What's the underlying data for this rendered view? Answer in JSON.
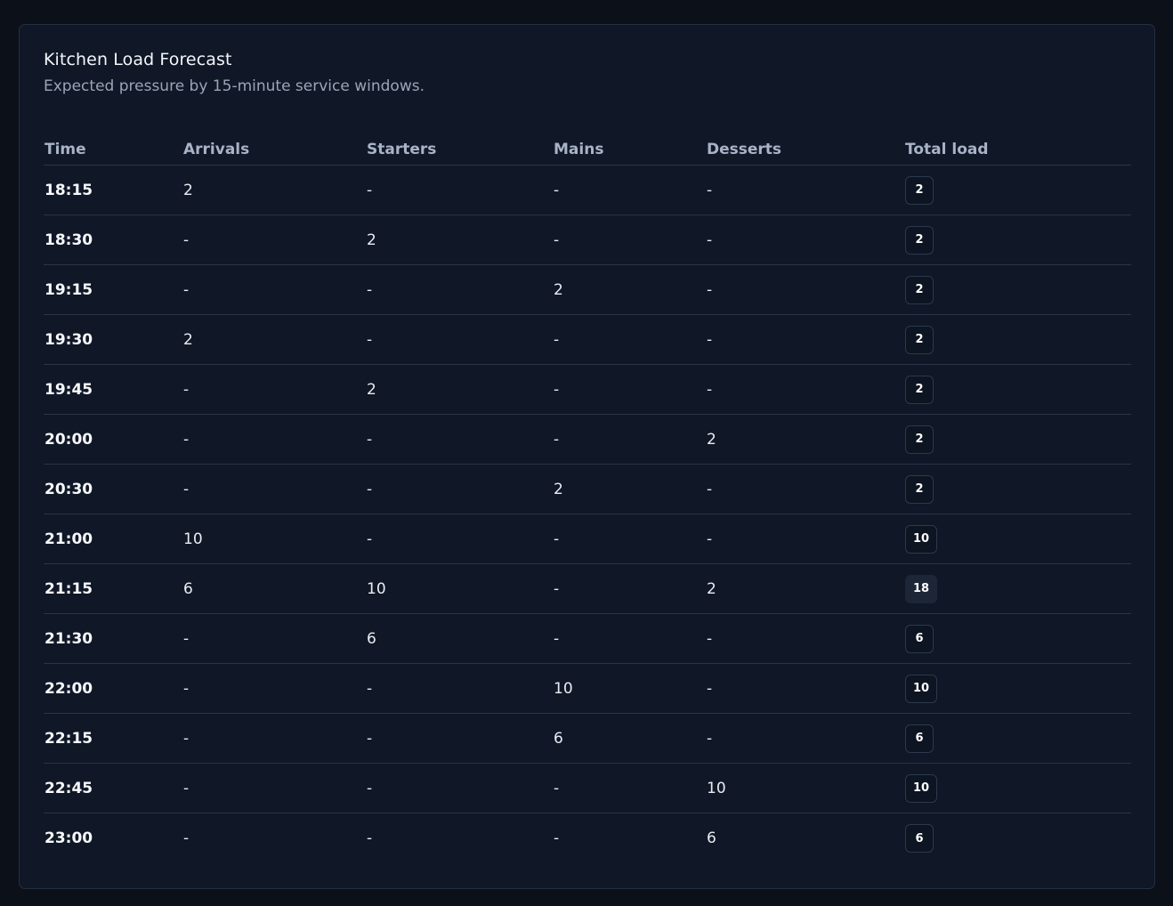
{
  "card": {
    "title": "Kitchen Load Forecast",
    "subtitle": "Expected pressure by 15-minute service windows."
  },
  "table": {
    "headers": [
      "Time",
      "Arrivals",
      "Starters",
      "Mains",
      "Desserts",
      "Total load"
    ],
    "rows": [
      [
        "18:15",
        "2",
        "-",
        "-",
        "-",
        "2"
      ],
      [
        "18:30",
        "-",
        "2",
        "-",
        "-",
        "2"
      ],
      [
        "19:15",
        "-",
        "-",
        "2",
        "-",
        "2"
      ],
      [
        "19:30",
        "2",
        "-",
        "-",
        "-",
        "2"
      ],
      [
        "19:45",
        "-",
        "2",
        "-",
        "-",
        "2"
      ],
      [
        "20:00",
        "-",
        "-",
        "-",
        "2",
        "2"
      ],
      [
        "20:30",
        "-",
        "-",
        "2",
        "-",
        "2"
      ],
      [
        "21:00",
        "10",
        "-",
        "-",
        "-",
        "10"
      ],
      [
        "21:15",
        "6",
        "10",
        "-",
        "2",
        "18"
      ],
      [
        "21:30",
        "-",
        "6",
        "-",
        "-",
        "6"
      ],
      [
        "22:00",
        "-",
        "-",
        "10",
        "-",
        "10"
      ],
      [
        "22:15",
        "-",
        "-",
        "6",
        "-",
        "6"
      ],
      [
        "22:45",
        "-",
        "-",
        "-",
        "10",
        "10"
      ],
      [
        "23:00",
        "-",
        "-",
        "-",
        "6",
        "6"
      ]
    ]
  },
  "colors": {
    "background": "#0b1019",
    "panel": "#101726",
    "border": "#2a3548",
    "header_text": "#a8b3c7",
    "time_text": "#f6f8fc",
    "value_text": "#e9edf5",
    "badge_bg": "#0d1422",
    "badge_high_bg": "#1d2637"
  }
}
